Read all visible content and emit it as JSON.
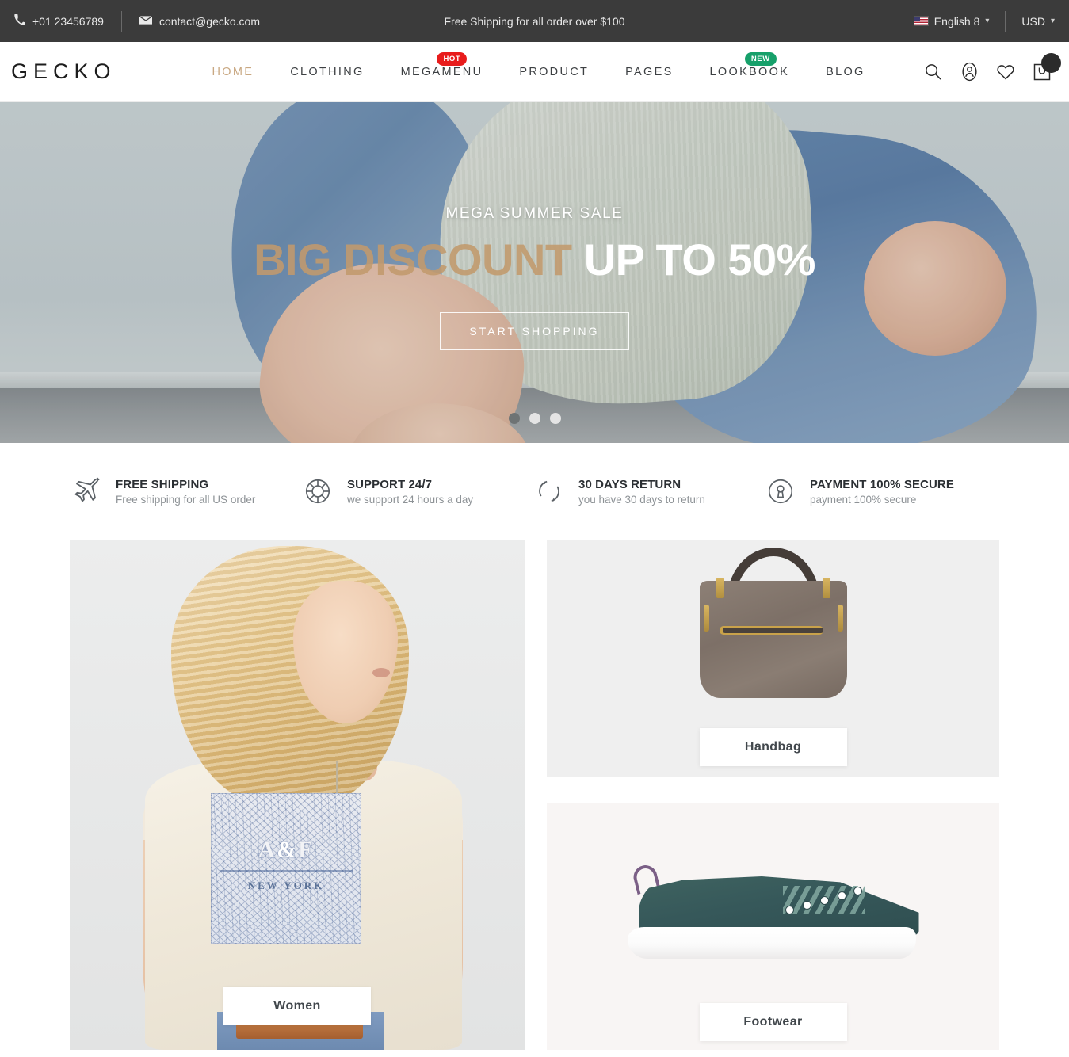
{
  "topbar": {
    "phone": "+01 23456789",
    "email": "contact@gecko.com",
    "promo": "Free Shipping for all order over $100",
    "language": "English 8",
    "currency": "USD",
    "phone_icon": "phone-icon",
    "mail_icon": "envelope-icon",
    "flag_icon": "us-flag-icon",
    "caret": "⌄"
  },
  "header": {
    "logo": "GECKO",
    "nav": [
      {
        "label": "HOME",
        "active": true,
        "badge": null
      },
      {
        "label": "CLOTHING",
        "active": false,
        "badge": null
      },
      {
        "label": "MEGAMENU",
        "active": false,
        "badge": "HOT",
        "badge_type": "hot"
      },
      {
        "label": "PRODUCT",
        "active": false,
        "badge": null
      },
      {
        "label": "PAGES",
        "active": false,
        "badge": null
      },
      {
        "label": "LOOKBOOK",
        "active": false,
        "badge": "NEW",
        "badge_type": "new"
      },
      {
        "label": "BLOG",
        "active": false,
        "badge": null
      }
    ],
    "icons": [
      "search-icon",
      "user-account-icon",
      "wishlist-heart-icon",
      "shopping-cart-icon"
    ]
  },
  "hero": {
    "kicker": "MEGA SUMMER SALE",
    "title_highlight": "BIG DISCOUNT ",
    "title_rest": "UP TO 50%",
    "button": "START SHOPPING",
    "slide_count": 3,
    "active_slide": 1
  },
  "features": [
    {
      "icon": "airplane-icon",
      "title": "FREE SHIPPING",
      "subtitle": "Free shipping for all US order"
    },
    {
      "icon": "lifebuoy-support-icon",
      "title": "SUPPORT 24/7",
      "subtitle": "we support 24 hours a day"
    },
    {
      "icon": "return-arrows-icon",
      "title": "30 DAYS RETURN",
      "subtitle": "you have 30 days to return"
    },
    {
      "icon": "lock-keyhole-icon",
      "title": "PAYMENT 100% SECURE",
      "subtitle": "payment 100% secure"
    }
  ],
  "categories": {
    "women": {
      "label": "Women"
    },
    "handbag": {
      "label": "Handbag"
    },
    "footwear": {
      "label": "Footwear"
    }
  },
  "tshirt_print": {
    "brand": "A",
    "amp": "&",
    "brand2": "F",
    "city": "NEW YORK"
  },
  "colors": {
    "topbar_bg": "#3b3b3b",
    "accent_gold": "#c9a882",
    "badge_hot": "#e81c1c",
    "badge_new": "#16a06a",
    "panel_gray": "#efefef",
    "panel_warm": "#f8f5f4"
  }
}
